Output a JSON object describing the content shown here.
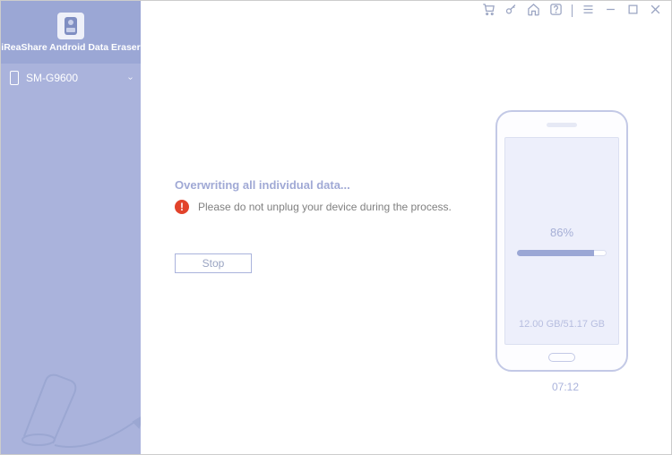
{
  "app": {
    "name": "iReaShare Android Data Eraser"
  },
  "sidebar": {
    "device": {
      "name": "SM-G9600"
    }
  },
  "main": {
    "status_title": "Overwriting all individual data...",
    "warning_text": "Please do not unplug your device during the process.",
    "stop_label": "Stop"
  },
  "phone": {
    "percent_label": "86%",
    "percent_value": 86,
    "storage_used": "12.00 GB",
    "storage_total": "51.17 GB",
    "storage_label": "12.00 GB/51.17 GB",
    "elapsed_time": "07:12"
  }
}
